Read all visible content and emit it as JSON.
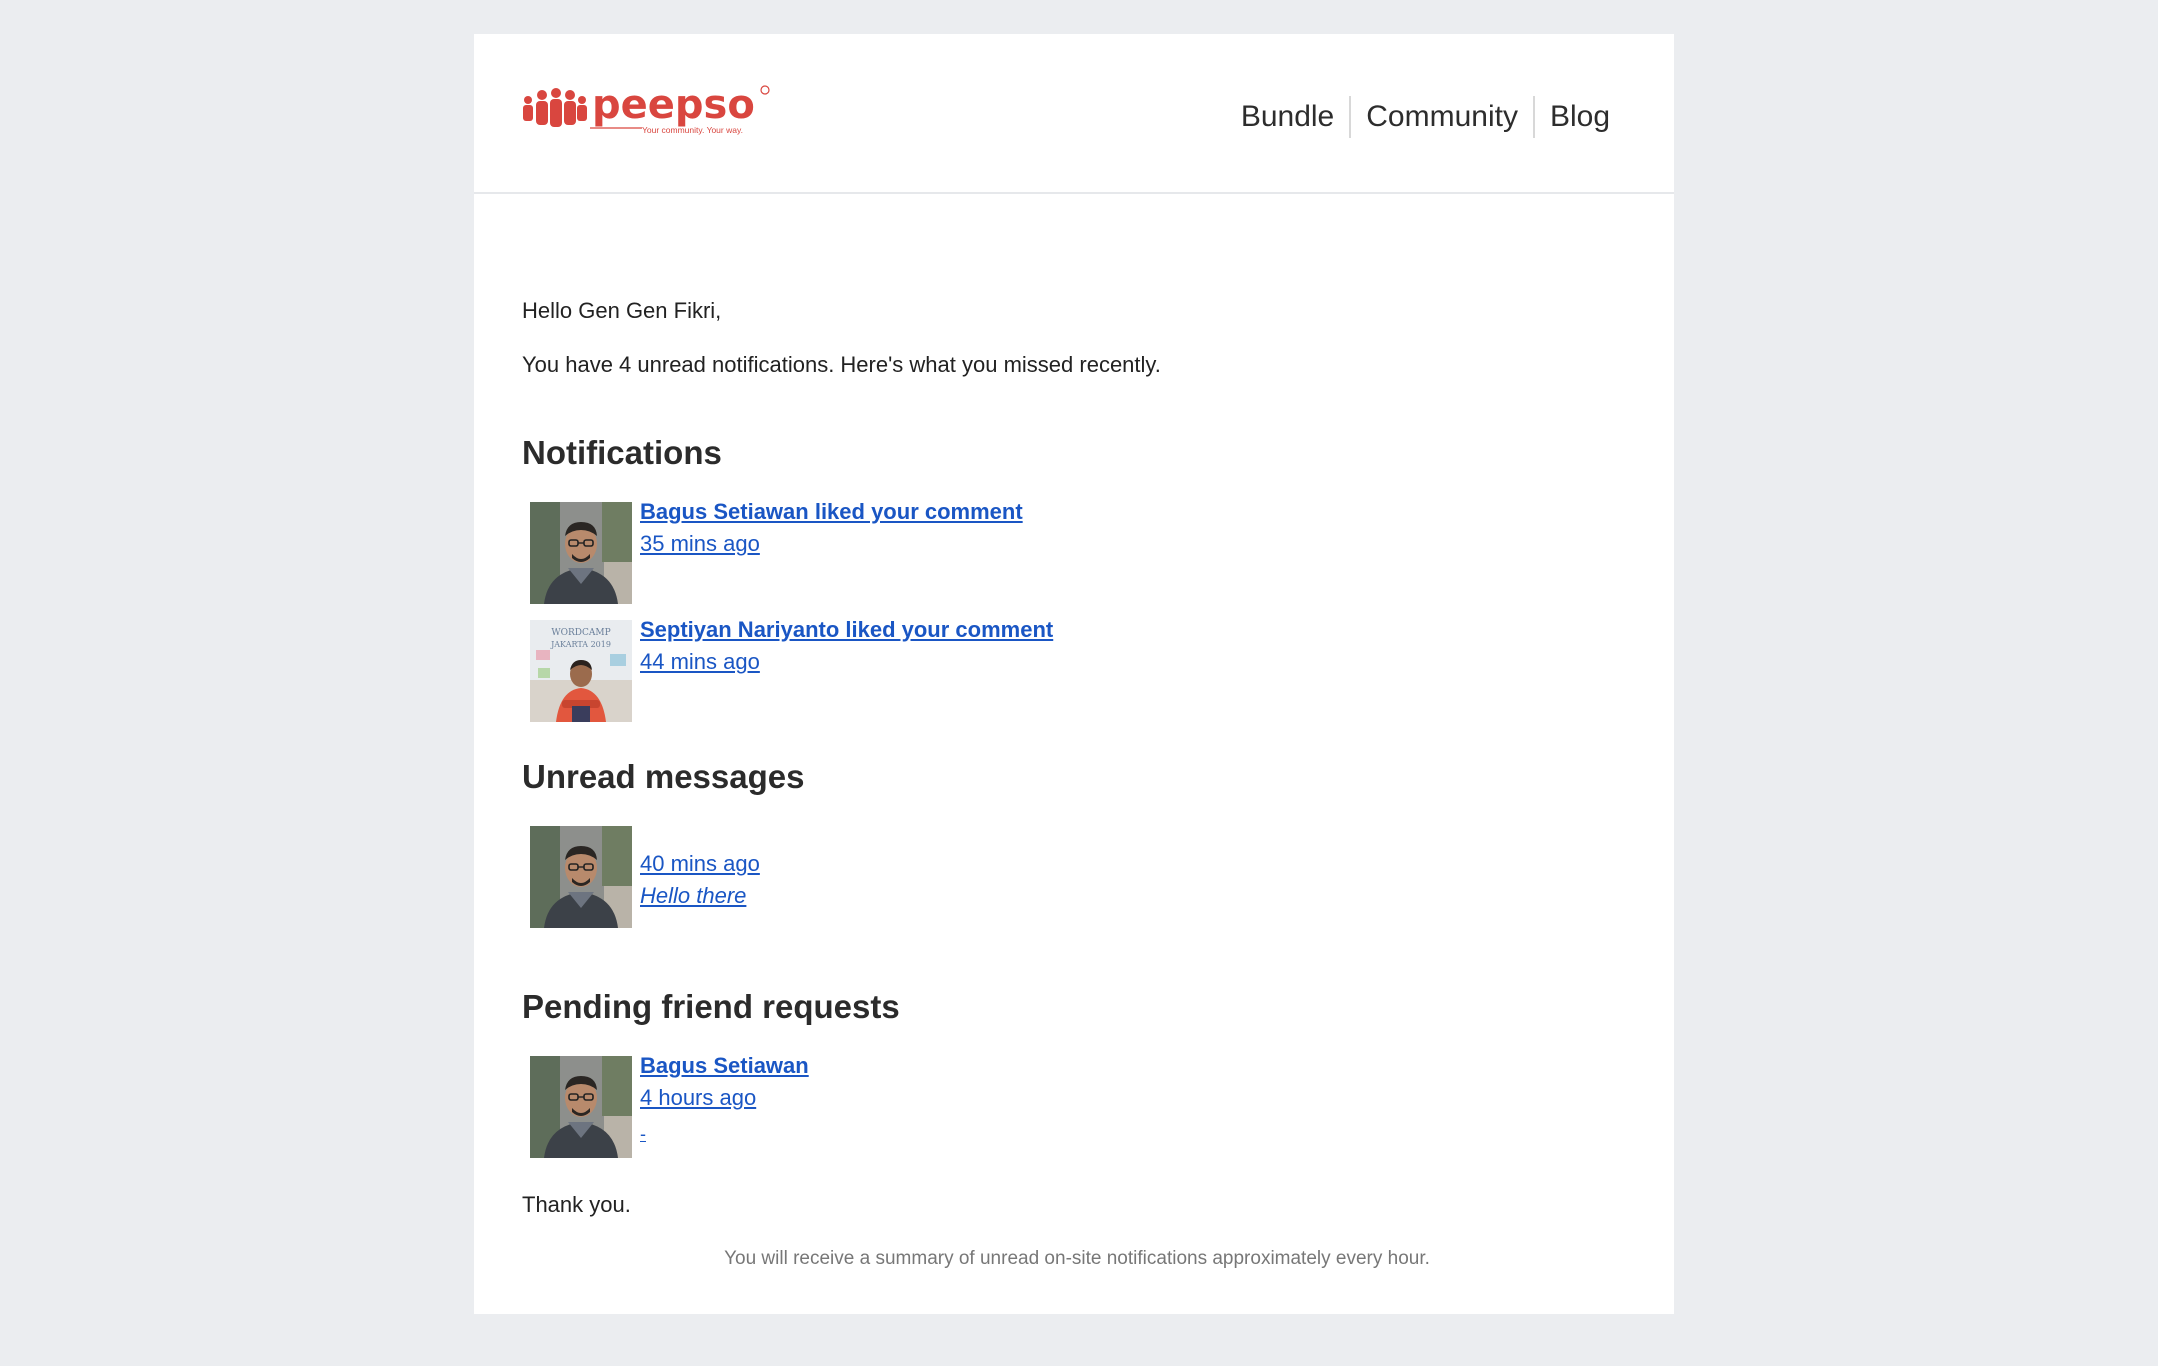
{
  "header": {
    "brand": {
      "name": "peepso",
      "tagline": "Your community. Your way.",
      "color": "#d9463f"
    },
    "nav": [
      {
        "label": "Bundle"
      },
      {
        "label": "Community"
      },
      {
        "label": "Blog"
      }
    ]
  },
  "body": {
    "greeting": "Hello Gen Gen Fikri,",
    "intro": "You have 4 unread notifications. Here's what you missed recently.",
    "notifications": {
      "title": "Notifications",
      "items": [
        {
          "text": "Bagus Setiawan liked your comment",
          "time": "35 mins ago",
          "avatar": "man-with-glasses-avatar"
        },
        {
          "text": "Septiyan Nariyanto liked your comment",
          "time": "44 mins ago",
          "avatar": "wordcamp-jakarta-avatar"
        }
      ]
    },
    "messages": {
      "title": "Unread messages",
      "items": [
        {
          "time": "40 mins ago",
          "preview": "Hello there",
          "avatar": "man-with-glasses-avatar"
        }
      ]
    },
    "friend_requests": {
      "title": "Pending friend requests",
      "items": [
        {
          "name": "Bagus Setiawan",
          "time": "4 hours ago",
          "extra": "-",
          "avatar": "man-with-glasses-avatar"
        }
      ]
    },
    "thanks": "Thank you.",
    "footer_note": "You will receive a summary of unread on-site notifications approximately every hour."
  },
  "colors": {
    "page_background": "#ebedf0",
    "card_background": "#ffffff",
    "link": "#1a56c4",
    "brand": "#d9463f"
  }
}
